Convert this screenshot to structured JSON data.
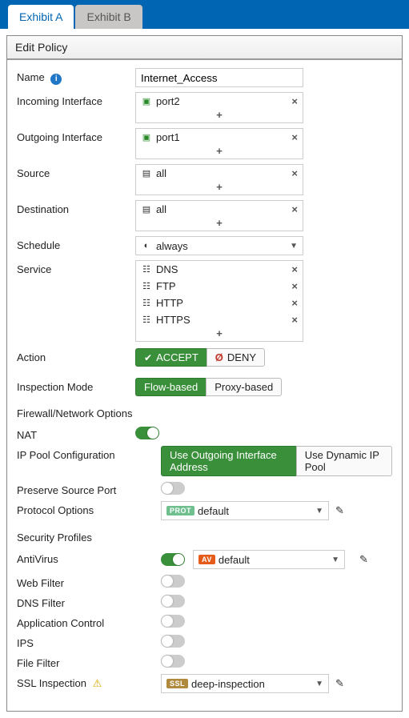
{
  "tabs": {
    "a": "Exhibit A",
    "b": "Exhibit B"
  },
  "panel_title": "Edit Policy",
  "labels": {
    "name": "Name",
    "incoming": "Incoming Interface",
    "outgoing": "Outgoing Interface",
    "source": "Source",
    "destination": "Destination",
    "schedule": "Schedule",
    "service": "Service",
    "action": "Action",
    "inspection": "Inspection Mode",
    "fw_section": "Firewall/Network Options",
    "nat": "NAT",
    "ippool": "IP Pool Configuration",
    "preserve": "Preserve Source Port",
    "protocol": "Protocol Options",
    "sec_section": "Security Profiles",
    "av": "AntiVirus",
    "webfilter": "Web Filter",
    "dnsfilter": "DNS Filter",
    "appctrl": "Application Control",
    "ips": "IPS",
    "filefilter": "File Filter",
    "ssl": "SSL Inspection"
  },
  "values": {
    "name": "Internet_Access",
    "incoming": "port2",
    "outgoing": "port1",
    "source": "all",
    "destination": "all",
    "schedule": "always",
    "services": {
      "s0": "DNS",
      "s1": "FTP",
      "s2": "HTTP",
      "s3": "HTTPS"
    },
    "protocol": "default",
    "av": "default",
    "ssl": "deep-inspection"
  },
  "buttons": {
    "accept": "ACCEPT",
    "deny": "DENY",
    "flow": "Flow-based",
    "proxy": "Proxy-based",
    "ippool_out": "Use Outgoing Interface Address",
    "ippool_dyn": "Use Dynamic IP Pool"
  },
  "badges": {
    "prot": "PROT",
    "av": "AV",
    "ssl": "SSL"
  },
  "glyphs": {
    "add": "+",
    "remove": "×",
    "caret": "▼",
    "check": "✔",
    "deny": "Ø",
    "pencil": "✎",
    "warn": "⚠"
  }
}
